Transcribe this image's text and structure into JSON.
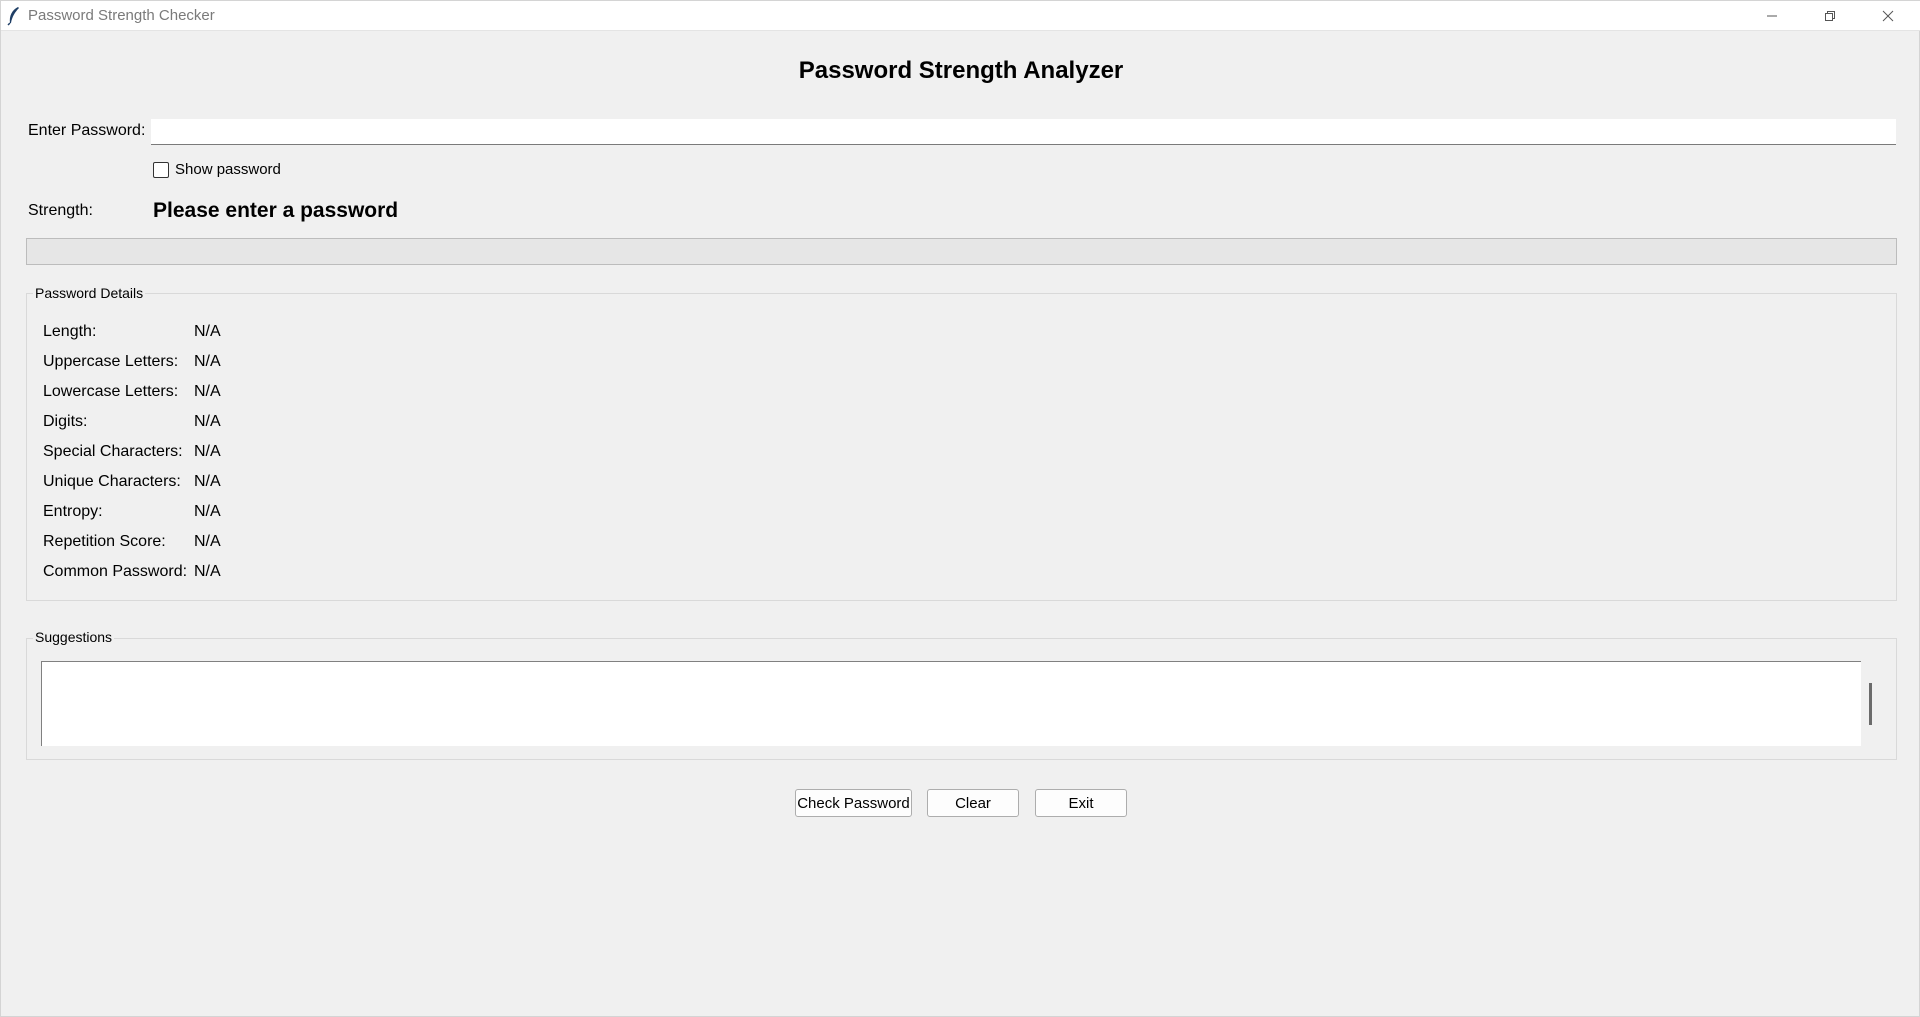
{
  "window": {
    "title": "Password Strength Checker"
  },
  "heading": "Password Strength Analyzer",
  "password": {
    "label": "Enter Password:",
    "value": "",
    "show_label": "Show password",
    "show_checked": false
  },
  "strength": {
    "label": "Strength:",
    "value": "Please enter a password",
    "progress": 0
  },
  "details": {
    "title": "Password Details",
    "rows": [
      {
        "label": "Length:",
        "value": "N/A"
      },
      {
        "label": "Uppercase Letters:",
        "value": "N/A"
      },
      {
        "label": "Lowercase Letters:",
        "value": "N/A"
      },
      {
        "label": "Digits:",
        "value": "N/A"
      },
      {
        "label": "Special Characters:",
        "value": "N/A"
      },
      {
        "label": "Unique Characters:",
        "value": "N/A"
      },
      {
        "label": "Entropy:",
        "value": "N/A"
      },
      {
        "label": "Repetition Score:",
        "value": "N/A"
      },
      {
        "label": "Common Password:",
        "value": "N/A"
      }
    ]
  },
  "suggestions": {
    "title": "Suggestions",
    "text": ""
  },
  "buttons": {
    "check": "Check Password",
    "clear": "Clear",
    "exit": "Exit"
  }
}
